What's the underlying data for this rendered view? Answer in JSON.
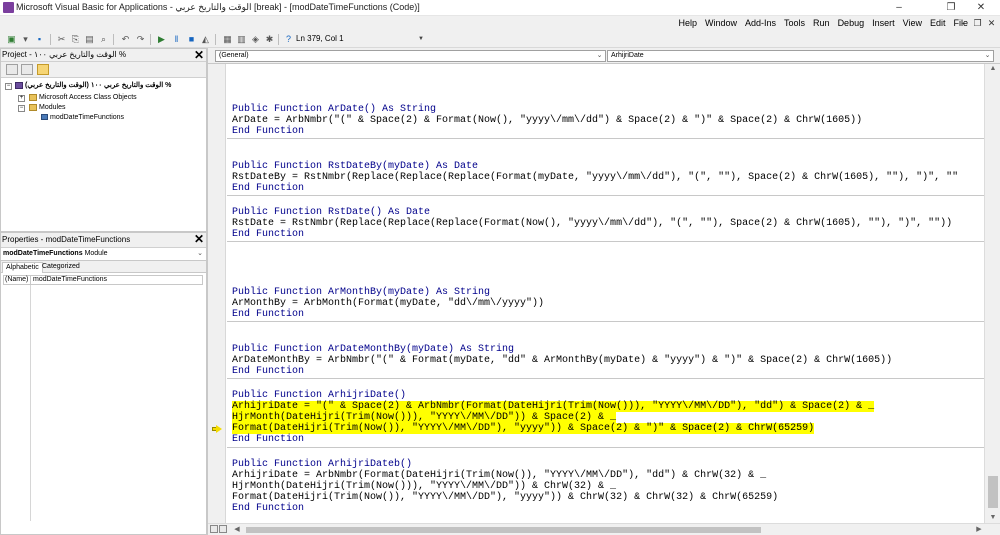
{
  "window": {
    "title": "Microsoft Visual Basic for Applications - الوقت والتاريخ عربي [break] - [modDateTimeFunctions (Code)]",
    "controls": {
      "minimize": "–",
      "restore": "❐",
      "close": "✕"
    }
  },
  "menubar": {
    "items": [
      "File",
      "Edit",
      "View",
      "Insert",
      "Debug",
      "Run",
      "Tools",
      "Add-Ins",
      "Window",
      "Help"
    ],
    "mdi": {
      "minimize": "-",
      "restore": "❐",
      "close": "✕"
    }
  },
  "toolbar": {
    "status": "Ln 379, Col 1"
  },
  "project": {
    "header": "Project - الوقت والتاريخ عربي ١٠٠ %",
    "tree": {
      "root": "(الوقت والتاريخ عربي) الوقت والتاريخ عربي ١٠٠ %",
      "objects_folder": "Microsoft Access Class Objects",
      "modules_folder": "Modules",
      "module": "modDateTimeFunctions"
    }
  },
  "properties": {
    "header": "Properties - modDateTimeFunctions",
    "object_name": "modDateTimeFunctions",
    "object_type": "Module",
    "tabs": [
      "Alphabetic",
      "Categorized"
    ],
    "rows": [
      {
        "key": "(Name)",
        "value": "modDateTimeFunctions"
      }
    ]
  },
  "code_window": {
    "object_combo": "(General)",
    "proc_combo": "ArhijriDate",
    "lines": [
      "Public Function ArDate() As String",
      "ArDate = ArbNmbr(\"(\" & Space(2) & Format(Now(), \"yyyy\\/mm\\/dd\") & Space(2) & \")\" & Space(2) & ChrW(1605))",
      "End Function",
      "Public Function RstDateBy(myDate) As Date",
      "RstDateBy = RstNmbr(Replace(Replace(Replace(Format(myDate, \"yyyy\\/mm\\/dd\"), \"(\", \"\"), Space(2) & ChrW(1605), \"\"), \")\", \"\"",
      "End Function",
      "Public Function RstDate() As Date",
      "RstDate = RstNmbr(Replace(Replace(Replace(Format(Now(), \"yyyy\\/mm\\/dd\"), \"(\", \"\"), Space(2) & ChrW(1605), \"\"), \")\", \"\"))",
      "End Function",
      "Public Function ArMonthBy(myDate) As String",
      "ArMonthBy = ArbMonth(Format(myDate, \"dd\\/mm\\/yyyy\"))",
      "End Function",
      "Public Function ArDateMonthBy(myDate) As String",
      "ArDateMonthBy = ArbNmbr(\"(\" & Format(myDate, \"dd\" & ArMonthBy(myDate) & \"yyyy\") & \")\" & Space(2) & ChrW(1605))",
      "End Function",
      "Public Function ArhijriDate()",
      "ArhijriDate = \"(\" & Space(2) & ArbNmbr(Format(DateHijri(Trim(Now())), \"YYYY\\/MM\\/DD\"), \"dd\") & Space(2) & _",
      "HjrMonth(DateHijri(Trim(Now())), \"YYYY\\/MM\\/DD\")) & Space(2) & _",
      "Format(DateHijri(Trim(Now()), \"YYYY\\/MM\\/DD\"), \"yyyy\")) & Space(2) & \")\" & Space(2) & ChrW(65259)",
      "End Function",
      "Public Function ArhijriDateb()",
      "ArhijriDate = ArbNmbr(Format(DateHijri(Trim(Now()), \"YYYY\\/MM\\/DD\"), \"dd\") & ChrW(32) & _",
      "HjrMonth(DateHijri(Trim(Now())), \"YYYY\\/MM\\/DD\")) & ChrW(32) & _",
      "Format(DateHijri(Trim(Now()), \"YYYY\\/MM\\/DD\"), \"yyyy\")) & ChrW(32) & ChrW(32) & ChrW(65259)",
      "End Function"
    ]
  }
}
